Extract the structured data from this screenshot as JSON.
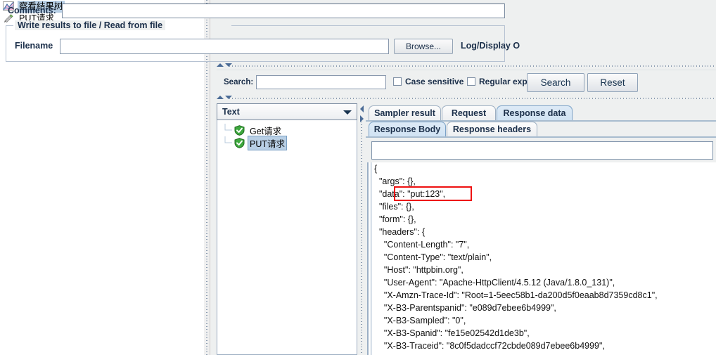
{
  "left_tree": {
    "items": [
      {
        "label": "察看结果树",
        "icon": "chart-icon",
        "selected": true
      },
      {
        "label": "PUT请求",
        "icon": "pencil-icon",
        "selected": false
      }
    ]
  },
  "comments": {
    "label": "Comments:",
    "value": "",
    "placeholder": ""
  },
  "write_group": {
    "title": "Write results to file / Read from file",
    "filename_label": "Filename",
    "filename_value": "",
    "browse_label": "Browse...",
    "log_display_label": "Log/Display O"
  },
  "search_bar": {
    "label": "Search:",
    "value": "",
    "case_sensitive_label": "Case sensitive",
    "case_sensitive_checked": false,
    "regular_exp_label": "Regular exp.",
    "regular_exp_checked": false,
    "search_button": "Search",
    "reset_button": "Reset"
  },
  "result_pane": {
    "renderer_selected": "Text",
    "renderer_options": [
      "Text"
    ],
    "tree": [
      {
        "label": "Get请求",
        "status": "success",
        "selected": false
      },
      {
        "label": "PUT请求",
        "status": "success",
        "selected": true
      }
    ]
  },
  "tabs": {
    "main": [
      {
        "label": "Sampler result",
        "active": false
      },
      {
        "label": "Request",
        "active": false
      },
      {
        "label": "Response data",
        "active": true
      }
    ],
    "sub": [
      {
        "label": "Response Body",
        "active": true
      },
      {
        "label": "Response headers",
        "active": false
      }
    ]
  },
  "find_field": {
    "value": "",
    "placeholder": ""
  },
  "response_body": {
    "text": "{\n  \"args\": {},\n  \"data\": \"put:123\",\n  \"files\": {},\n  \"form\": {},\n  \"headers\": {\n    \"Content-Length\": \"7\",\n    \"Content-Type\": \"text/plain\",\n    \"Host\": \"httpbin.org\",\n    \"User-Agent\": \"Apache-HttpClient/4.5.12 (Java/1.8.0_131)\",\n    \"X-Amzn-Trace-Id\": \"Root=1-5eec58b1-da200d5f0eaab8d7359cd8c1\",\n    \"X-B3-Parentspanid\": \"e089d7ebee6b4999\",\n    \"X-B3-Sampled\": \"0\",\n    \"X-B3-Spanid\": \"fe15e02542d1de3b\",\n    \"X-B3-Traceid\": \"8c0f5dadccf72cbde089d7ebee6b4999\","
  },
  "annotation": {
    "highlight_target": "\"data\": \"put:123\",",
    "highlight_color": "#ee1111"
  }
}
